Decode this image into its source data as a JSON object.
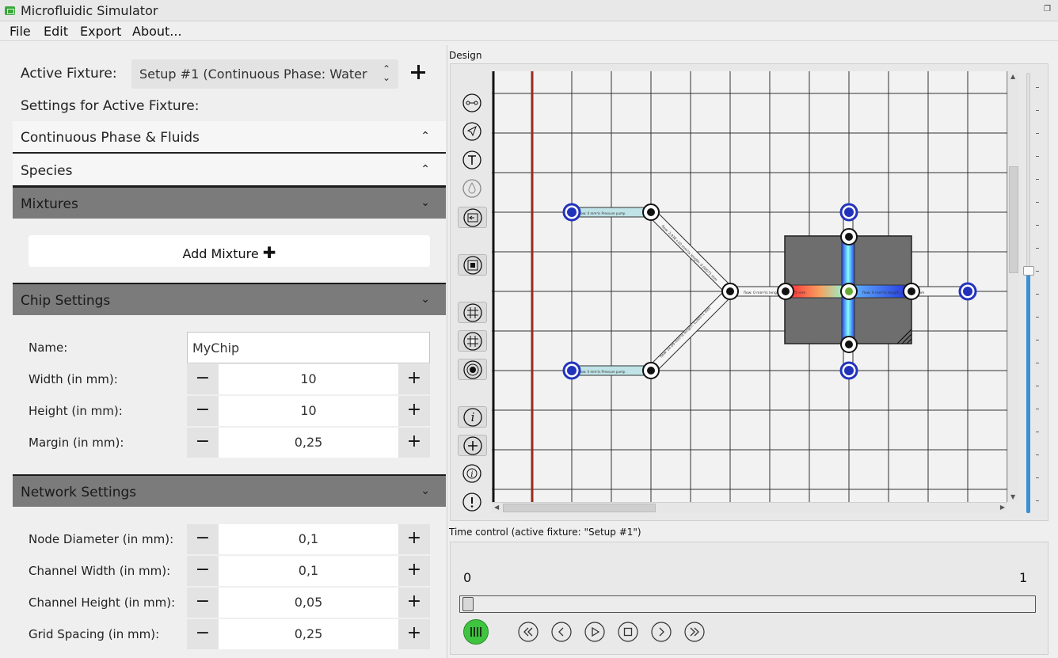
{
  "window": {
    "title": "Microfluidic Simulator",
    "restore_icon": "restore-icon"
  },
  "menu": [
    "File",
    "Edit",
    "Export",
    "About..."
  ],
  "fixture": {
    "label": "Active Fixture:",
    "value": "Setup #1 (Continuous Phase: Water",
    "settings_heading": "Settings for Active Fixture:"
  },
  "sections": {
    "continuous": "Continuous Phase & Fluids",
    "species": "Species",
    "mixtures": "Mixtures",
    "add_mixture": "Add Mixture",
    "chip": "Chip Settings",
    "network": "Network Settings"
  },
  "chip": {
    "name_label": "Name:",
    "name_value": "MyChip",
    "width_label": "Width (in mm):",
    "width_value": "10",
    "height_label": "Height (in mm):",
    "height_value": "10",
    "margin_label": "Margin (in mm):",
    "margin_value": "0,25"
  },
  "network": {
    "node_diameter_label": "Node Diameter (in mm):",
    "node_diameter_value": "0,1",
    "channel_width_label": "Channel Width (in mm):",
    "channel_width_value": "0,1",
    "channel_height_label": "Channel Height (in mm):",
    "channel_height_value": "0,05",
    "grid_spacing_label": "Grid Spacing (in mm):",
    "grid_spacing_value": "0,25"
  },
  "design": {
    "label": "Design",
    "channel_labels": {
      "pump_top": "flow: 0 mm³/s Pressure pump",
      "pump_bottom": "flow: 0 mm³/s Pressure pump",
      "diag_top": "flow: 2,93E+10 mm³/s length: 0,00071 mm",
      "diag_bottom": "flow: 1e-09 mm³/s length: 0,00071 mm",
      "mid": "flow: 0 mm³/s length: 0,00075 mm",
      "right": "flow: 0 mm³/s length: 0,00075 mm"
    },
    "zoom_level": 0.55
  },
  "time_control": {
    "label": "Time control (active fixture: \"Setup #1\")",
    "start": "0",
    "end": "1",
    "position": 0
  },
  "colors": {
    "node_blue": "#2233bb",
    "mixer_gray": "#6e6e6e",
    "accent_green": "#3ec43e",
    "wall_red": "#9b2a1a"
  }
}
